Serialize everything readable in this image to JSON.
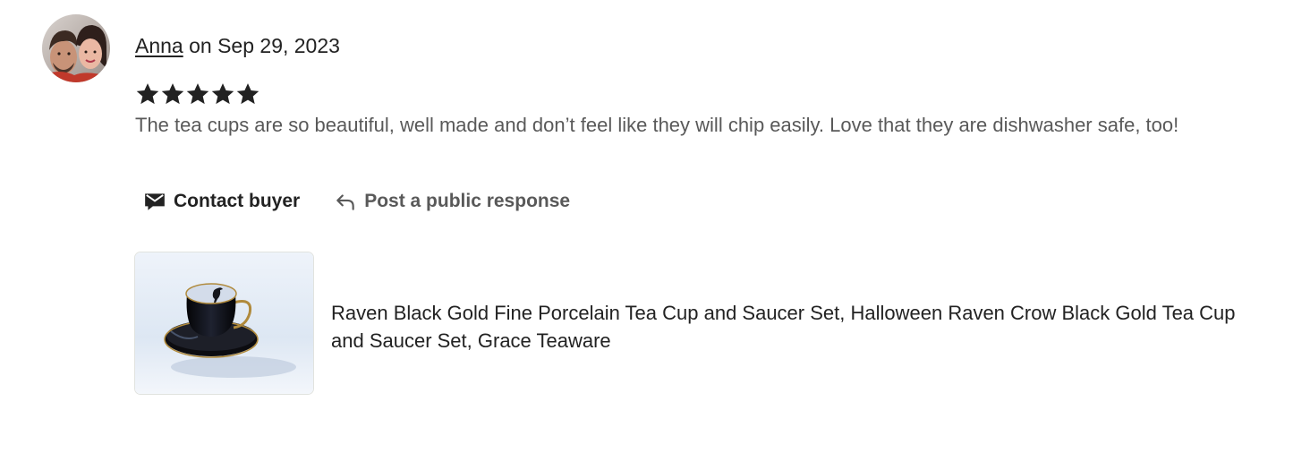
{
  "review": {
    "author": "Anna",
    "date_text": " on Sep 29, 2023",
    "rating": 5,
    "max_rating": 5,
    "text": "The tea cups are so beautiful, well made and don’t feel like they will chip easily. Love that they are dishwasher safe, too!"
  },
  "actions": {
    "contact_label": "Contact buyer",
    "respond_label": "Post a public response"
  },
  "product": {
    "title": "Raven Black Gold Fine Porcelain Tea Cup and Saucer Set, Halloween Raven Crow Black Gold Tea Cup and Saucer Set, Grace Teaware"
  },
  "colors": {
    "text_primary": "#222222",
    "text_secondary": "#595959",
    "star": "#222222"
  },
  "icons": {
    "contact": "envelope-icon",
    "respond": "reply-arrow-icon",
    "star": "star-icon"
  }
}
